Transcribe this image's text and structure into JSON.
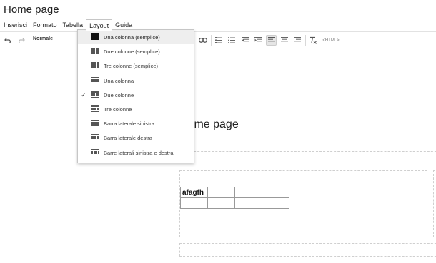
{
  "document": {
    "title": "Home page"
  },
  "menubar": {
    "items": [
      {
        "label": "Inserisci"
      },
      {
        "label": "Formato"
      },
      {
        "label": "Tabella"
      },
      {
        "label": "Layout"
      },
      {
        "label": "Guida"
      }
    ]
  },
  "toolbar": {
    "style_select": "Normale",
    "html_label": "<HTML>",
    "icons": [
      "undo-icon",
      "redo-icon",
      "link-icon",
      "numbered-list-icon",
      "bulleted-list-icon",
      "outdent-icon",
      "indent-icon",
      "align-left-icon",
      "align-center-icon",
      "align-right-icon",
      "clear-formatting-icon",
      "html-icon"
    ]
  },
  "layout_menu": {
    "items": [
      {
        "label": "Una colonna (semplice)",
        "icon": "layout-one-column-simple-icon",
        "highlighted": true
      },
      {
        "label": "Due colonne (semplice)",
        "icon": "layout-two-columns-simple-icon"
      },
      {
        "label": "Tre colonne (semplice)",
        "icon": "layout-three-columns-simple-icon"
      },
      {
        "label": "Una colonna",
        "icon": "layout-one-column-icon"
      },
      {
        "label": "Due colonne",
        "icon": "layout-two-columns-icon",
        "checked": true,
        "check_mark": "✓"
      },
      {
        "label": "Tre colonne",
        "icon": "layout-three-columns-icon"
      },
      {
        "label": "Barra laterale sinistra",
        "icon": "layout-left-sidebar-icon"
      },
      {
        "label": "Barra laterale destra",
        "icon": "layout-right-sidebar-icon"
      },
      {
        "label": "Barre laterali sinistra e destra",
        "icon": "layout-both-sidebars-icon"
      }
    ]
  },
  "editor": {
    "heading": "Home page",
    "table": [
      [
        "afagfh",
        "",
        "",
        ""
      ],
      [
        "",
        "",
        "",
        ""
      ]
    ]
  },
  "colors": {
    "menu_highlight": "#eeeeee",
    "border": "#c6c6c6",
    "dash": "#cfcfcf"
  }
}
